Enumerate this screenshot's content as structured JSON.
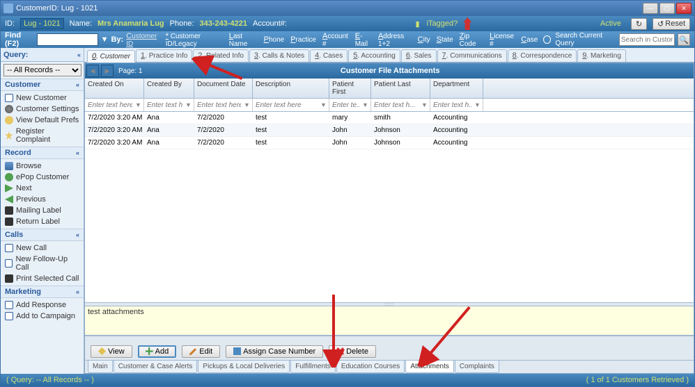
{
  "window": {
    "title": "CustomerID: Lug - 1021"
  },
  "winbtns": {
    "min": "—",
    "max": "▢",
    "close": "✕"
  },
  "infobar": {
    "id_label": "ID:",
    "id_value": "Lug - 1021",
    "name_label": "Name:",
    "name_value": "Mrs Anamaria Lug",
    "phone_label": "Phone:",
    "phone_value": "343-243-4221",
    "account_label": "Account#:",
    "tagged_label": "iTagged?",
    "active_label": "Active",
    "reset_label": "Reset"
  },
  "findbar": {
    "find_label": "Find (F2)",
    "by_label": "By:",
    "by_links": [
      "Customer ID",
      "* Customer ID/Legacy",
      "Last Name",
      "Phone",
      "Practice",
      "Account #",
      "E-Mail",
      "Address 1+2",
      "City",
      "State",
      "Zip Code",
      "License #",
      "Case"
    ],
    "search_label": "Search Current Query",
    "search_placeholder": "Search in Customer"
  },
  "sidebar": {
    "query_label": "Query:",
    "query_value": "-- All Records --",
    "panels": {
      "customer": {
        "title": "Customer",
        "items": [
          "New Customer",
          "Customer Settings",
          "View Default Prefs",
          "Register Complaint"
        ]
      },
      "record": {
        "title": "Record",
        "items": [
          "Browse",
          "ePop Customer",
          "Next",
          "Previous",
          "Mailing Label",
          "Return Label"
        ]
      },
      "calls": {
        "title": "Calls",
        "items": [
          "New Call",
          "New Follow-Up Call",
          "Print Selected Call"
        ]
      },
      "marketing": {
        "title": "Marketing",
        "items": [
          "Add Response",
          "Add to Campaign"
        ]
      }
    }
  },
  "tabs_top": [
    {
      "pre": "0",
      "label": "Customer"
    },
    {
      "pre": "1",
      "label": "Practice Info"
    },
    {
      "pre": "2",
      "label": "Related Info"
    },
    {
      "pre": "3",
      "label": "Calls & Notes"
    },
    {
      "pre": "4",
      "label": "Cases"
    },
    {
      "pre": "5",
      "label": "Accounting"
    },
    {
      "pre": "6",
      "label": "Sales"
    },
    {
      "pre": "7",
      "label": "Communications"
    },
    {
      "pre": "8",
      "label": "Correspondence"
    },
    {
      "pre": "9",
      "label": "Marketing"
    }
  ],
  "grid": {
    "title": "Customer File Attachments",
    "page_label": "Page: 1",
    "headers": [
      "Created On",
      "Created By",
      "Document Date",
      "Description",
      "Patient First",
      "Patient Last",
      "Department"
    ],
    "filter_placeholder": [
      "Enter text here",
      "Enter text h...",
      "Enter text here",
      "Enter text here",
      "Enter te...",
      "Enter text h...",
      "Enter text h..."
    ],
    "rows": [
      {
        "created_on": "7/2/2020 3:20 AM",
        "created_by": "Ana",
        "doc_date": "7/2/2020",
        "desc": "test",
        "pfirst": "mary",
        "plast": "smith",
        "dept": "Accounting"
      },
      {
        "created_on": "7/2/2020 3:20 AM",
        "created_by": "Ana",
        "doc_date": "7/2/2020",
        "desc": "test",
        "pfirst": "John",
        "plast": "Johnson",
        "dept": "Accounting"
      },
      {
        "created_on": "7/2/2020 3:20 AM",
        "created_by": "Ana",
        "doc_date": "7/2/2020",
        "desc": "test",
        "pfirst": "John",
        "plast": "Johnson",
        "dept": "Accounting"
      }
    ]
  },
  "notes": {
    "text": "test attachments"
  },
  "actions": {
    "view": "View",
    "add": "Add",
    "edit": "Edit",
    "assign": "Assign Case Number",
    "delete": "Delete"
  },
  "tabs_bottom": [
    "Main",
    "Customer & Case Alerts",
    "Pickups & Local Deliveries",
    "Fulfillments",
    "Education Courses",
    "Attachments",
    "Complaints"
  ],
  "status": {
    "left": "( Query: -- All Records -- )",
    "right": "( 1 of 1 Customers Retrieved )"
  }
}
